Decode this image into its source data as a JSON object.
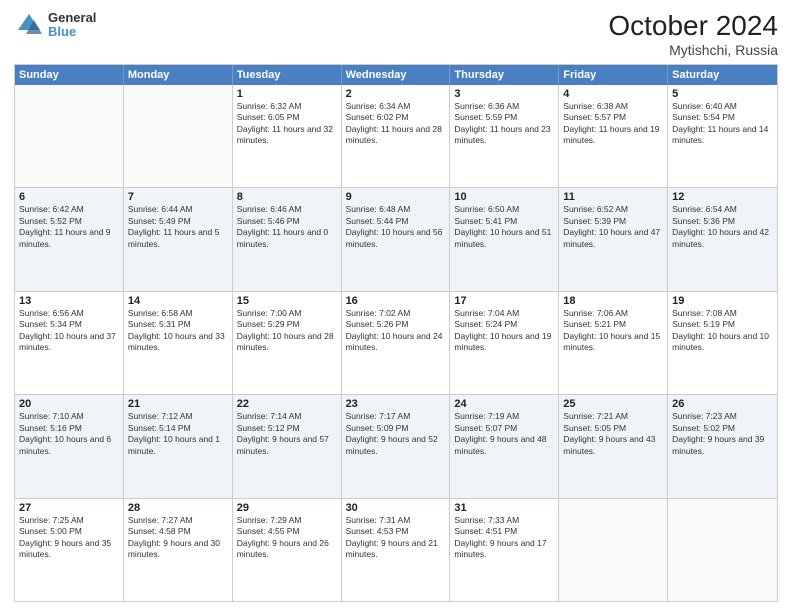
{
  "logo": {
    "general": "General",
    "blue": "Blue"
  },
  "title": {
    "month": "October 2024",
    "location": "Mytishchi, Russia"
  },
  "header_days": [
    "Sunday",
    "Monday",
    "Tuesday",
    "Wednesday",
    "Thursday",
    "Friday",
    "Saturday"
  ],
  "weeks": [
    [
      {
        "day": "",
        "content": ""
      },
      {
        "day": "",
        "content": ""
      },
      {
        "day": "1",
        "content": "Sunrise: 6:32 AM\nSunset: 6:05 PM\nDaylight: 11 hours and 32 minutes."
      },
      {
        "day": "2",
        "content": "Sunrise: 6:34 AM\nSunset: 6:02 PM\nDaylight: 11 hours and 28 minutes."
      },
      {
        "day": "3",
        "content": "Sunrise: 6:36 AM\nSunset: 5:59 PM\nDaylight: 11 hours and 23 minutes."
      },
      {
        "day": "4",
        "content": "Sunrise: 6:38 AM\nSunset: 5:57 PM\nDaylight: 11 hours and 19 minutes."
      },
      {
        "day": "5",
        "content": "Sunrise: 6:40 AM\nSunset: 5:54 PM\nDaylight: 11 hours and 14 minutes."
      }
    ],
    [
      {
        "day": "6",
        "content": "Sunrise: 6:42 AM\nSunset: 5:52 PM\nDaylight: 11 hours and 9 minutes."
      },
      {
        "day": "7",
        "content": "Sunrise: 6:44 AM\nSunset: 5:49 PM\nDaylight: 11 hours and 5 minutes."
      },
      {
        "day": "8",
        "content": "Sunrise: 6:46 AM\nSunset: 5:46 PM\nDaylight: 11 hours and 0 minutes."
      },
      {
        "day": "9",
        "content": "Sunrise: 6:48 AM\nSunset: 5:44 PM\nDaylight: 10 hours and 56 minutes."
      },
      {
        "day": "10",
        "content": "Sunrise: 6:50 AM\nSunset: 5:41 PM\nDaylight: 10 hours and 51 minutes."
      },
      {
        "day": "11",
        "content": "Sunrise: 6:52 AM\nSunset: 5:39 PM\nDaylight: 10 hours and 47 minutes."
      },
      {
        "day": "12",
        "content": "Sunrise: 6:54 AM\nSunset: 5:36 PM\nDaylight: 10 hours and 42 minutes."
      }
    ],
    [
      {
        "day": "13",
        "content": "Sunrise: 6:56 AM\nSunset: 5:34 PM\nDaylight: 10 hours and 37 minutes."
      },
      {
        "day": "14",
        "content": "Sunrise: 6:58 AM\nSunset: 5:31 PM\nDaylight: 10 hours and 33 minutes."
      },
      {
        "day": "15",
        "content": "Sunrise: 7:00 AM\nSunset: 5:29 PM\nDaylight: 10 hours and 28 minutes."
      },
      {
        "day": "16",
        "content": "Sunrise: 7:02 AM\nSunset: 5:26 PM\nDaylight: 10 hours and 24 minutes."
      },
      {
        "day": "17",
        "content": "Sunrise: 7:04 AM\nSunset: 5:24 PM\nDaylight: 10 hours and 19 minutes."
      },
      {
        "day": "18",
        "content": "Sunrise: 7:06 AM\nSunset: 5:21 PM\nDaylight: 10 hours and 15 minutes."
      },
      {
        "day": "19",
        "content": "Sunrise: 7:08 AM\nSunset: 5:19 PM\nDaylight: 10 hours and 10 minutes."
      }
    ],
    [
      {
        "day": "20",
        "content": "Sunrise: 7:10 AM\nSunset: 5:16 PM\nDaylight: 10 hours and 6 minutes."
      },
      {
        "day": "21",
        "content": "Sunrise: 7:12 AM\nSunset: 5:14 PM\nDaylight: 10 hours and 1 minute."
      },
      {
        "day": "22",
        "content": "Sunrise: 7:14 AM\nSunset: 5:12 PM\nDaylight: 9 hours and 57 minutes."
      },
      {
        "day": "23",
        "content": "Sunrise: 7:17 AM\nSunset: 5:09 PM\nDaylight: 9 hours and 52 minutes."
      },
      {
        "day": "24",
        "content": "Sunrise: 7:19 AM\nSunset: 5:07 PM\nDaylight: 9 hours and 48 minutes."
      },
      {
        "day": "25",
        "content": "Sunrise: 7:21 AM\nSunset: 5:05 PM\nDaylight: 9 hours and 43 minutes."
      },
      {
        "day": "26",
        "content": "Sunrise: 7:23 AM\nSunset: 5:02 PM\nDaylight: 9 hours and 39 minutes."
      }
    ],
    [
      {
        "day": "27",
        "content": "Sunrise: 7:25 AM\nSunset: 5:00 PM\nDaylight: 9 hours and 35 minutes."
      },
      {
        "day": "28",
        "content": "Sunrise: 7:27 AM\nSunset: 4:58 PM\nDaylight: 9 hours and 30 minutes."
      },
      {
        "day": "29",
        "content": "Sunrise: 7:29 AM\nSunset: 4:55 PM\nDaylight: 9 hours and 26 minutes."
      },
      {
        "day": "30",
        "content": "Sunrise: 7:31 AM\nSunset: 4:53 PM\nDaylight: 9 hours and 21 minutes."
      },
      {
        "day": "31",
        "content": "Sunrise: 7:33 AM\nSunset: 4:51 PM\nDaylight: 9 hours and 17 minutes."
      },
      {
        "day": "",
        "content": ""
      },
      {
        "day": "",
        "content": ""
      }
    ]
  ]
}
